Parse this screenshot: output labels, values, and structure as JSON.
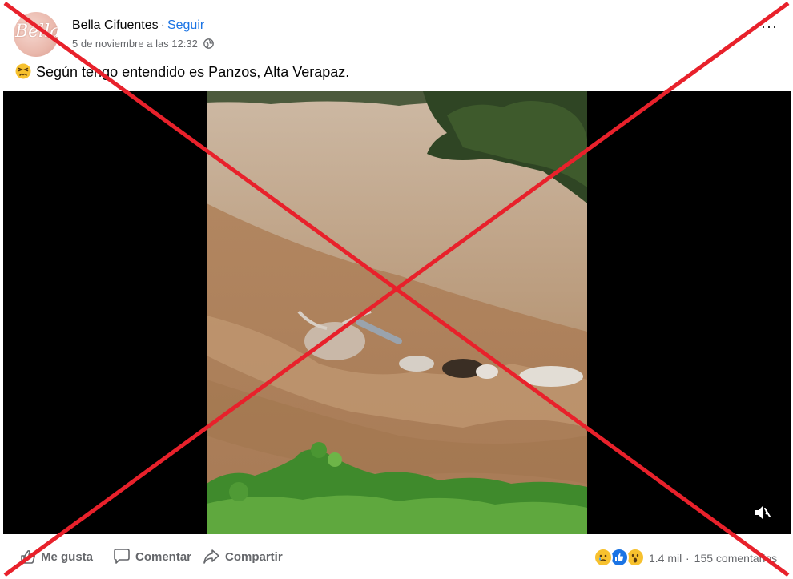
{
  "post": {
    "author": "Bella Cifuentes",
    "separator": "·",
    "follow_label": "Seguir",
    "timestamp": "5 de noviembre a las 12:32",
    "avatar_text": "Bella",
    "caption": "Según tengo entendido es Panzos, Alta Verapaz.",
    "caption_emoji": "persevering-face-emoji",
    "more_icon": "···"
  },
  "video": {
    "mute_icon": "volume-muted-icon"
  },
  "actions": {
    "like_label": "Me gusta",
    "comment_label": "Comentar",
    "share_label": "Compartir"
  },
  "stats": {
    "reaction_icons": [
      "sad-reaction-icon",
      "like-reaction-icon",
      "wow-reaction-icon"
    ],
    "reaction_count": "1.4 mil",
    "separator": "·",
    "comment_count": "155 comentarios"
  },
  "colors": {
    "link": "#1b74e4",
    "secondary_text": "#65676b",
    "overlay_cross": "#e8212b",
    "water": "#b58a64"
  }
}
